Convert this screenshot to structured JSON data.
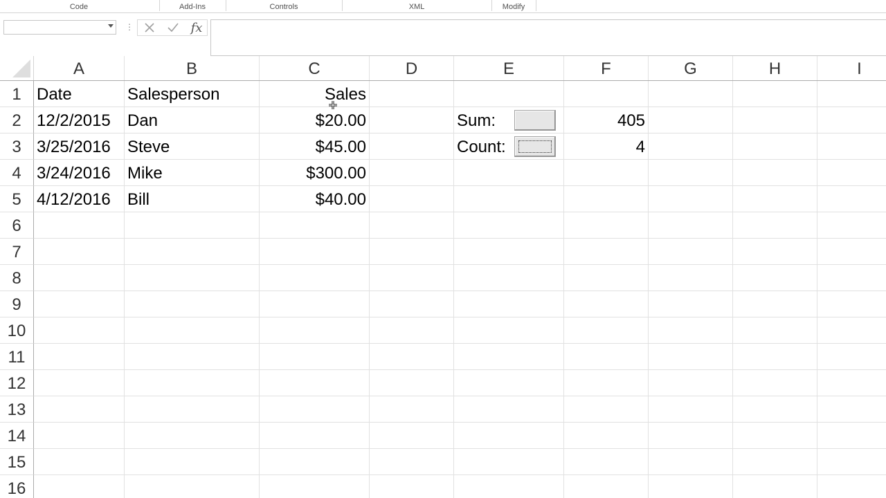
{
  "ribbon": {
    "groups": [
      "Code",
      "Add-Ins",
      "Controls",
      "XML",
      "Modify"
    ]
  },
  "formula_bar": {
    "name_box_value": "",
    "formula_value": "",
    "cancel_icon": "x-icon",
    "enter_icon": "checkmark-icon",
    "function_icon": "fx-icon",
    "function_label": "fx"
  },
  "columns": [
    "A",
    "B",
    "C",
    "D",
    "E",
    "F",
    "G",
    "H",
    "I"
  ],
  "rows": [
    "1",
    "2",
    "3",
    "4",
    "5",
    "6",
    "7",
    "8",
    "9",
    "10",
    "11",
    "12",
    "13",
    "14",
    "15",
    "16"
  ],
  "cells": {
    "A1": "Date",
    "B1": "Salesperson",
    "C1": "Sales",
    "A2": "12/2/2015",
    "B2": "Dan",
    "C2": "$20.00",
    "A3": "3/25/2016",
    "B3": "Steve",
    "C3": "$45.00",
    "A4": "3/24/2016",
    "B4": "Mike",
    "C4": "$300.00",
    "A5": "4/12/2016",
    "B5": "Bill",
    "C5": "$40.00",
    "E2": "Sum:",
    "F2": "405",
    "E3": "Count:",
    "F3": "4"
  },
  "form_controls": {
    "sum_button_label": "",
    "count_button_label": ""
  },
  "colors": {
    "grid_line": "#e1e1e1",
    "header_border": "#ababab",
    "button_face": "#e6e6e6"
  }
}
